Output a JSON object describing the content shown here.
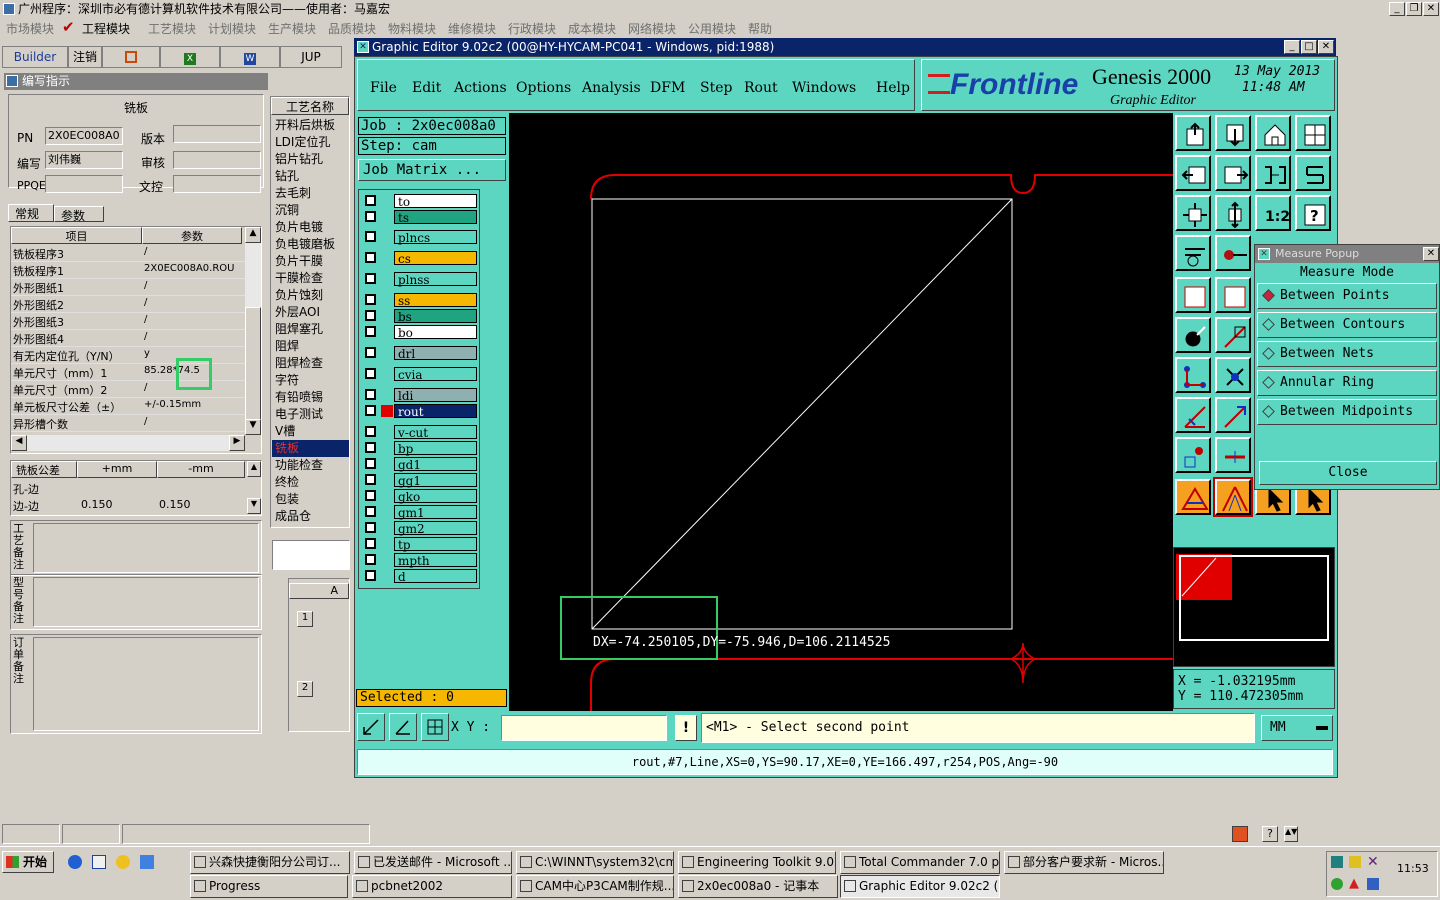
{
  "app": {
    "title": "广州程序：深圳市必有德计算机软件技术有限公司——使用者：马嘉宏",
    "menu": [
      "市场模块",
      "工程模块",
      "工艺模块",
      "计划模块",
      "生产模块",
      "品质模块",
      "物料模块",
      "维修模块",
      "行政模块",
      "成本模块",
      "网络模块",
      "公用模块",
      "帮助"
    ],
    "toolbar": [
      "Builder",
      "注销",
      "JUP"
    ]
  },
  "left": {
    "title": "编写指示",
    "board_type": "铣板",
    "fields": {
      "pn_label": "PN",
      "pn": "2X0EC008A0",
      "version_label": "版本",
      "version": "",
      "author_label": "编写",
      "author": "刘伟巍",
      "review_label": "审核",
      "review": "",
      "ppqe_label": "PPQE",
      "ppqe": "",
      "doc_control_label": "文控",
      "doc_control": ""
    },
    "tabs": [
      "常规",
      "参数"
    ],
    "grid_headers": [
      "项目",
      "参数"
    ],
    "grid_rows": [
      [
        "铣板程序3",
        "/"
      ],
      [
        "铣板程序1",
        "2X0EC008A0.ROU"
      ],
      [
        "外形图纸1",
        "/"
      ],
      [
        "外形图纸2",
        "/"
      ],
      [
        "外形图纸3",
        "/"
      ],
      [
        "外形图纸4",
        "/"
      ],
      [
        "有无内定位孔（Y/N）",
        "y"
      ],
      [
        "单元尺寸（mm）1",
        "85.28*74.5"
      ],
      [
        "单元尺寸（mm）2",
        "/"
      ],
      [
        "单元板尺寸公差（±）",
        "+/-0.15mm"
      ],
      [
        "异形槽个数",
        "/"
      ]
    ],
    "tol_headers": [
      "铣板公差",
      "+mm",
      "-mm"
    ],
    "tol_rows": [
      [
        "孔-边",
        "",
        ""
      ],
      [
        "边-边",
        "0.150",
        "0.150"
      ]
    ],
    "notes": [
      "工艺备注",
      "型号备注",
      "订单备注"
    ]
  },
  "process": {
    "header": "工艺名称",
    "items": [
      "开料后烘板",
      "LDI定位孔",
      "铝片钻孔",
      "钻孔",
      "去毛刺",
      "沉铜",
      "负片电镀",
      "负电镀磨板",
      "负片干膜",
      "干膜检查",
      "负片蚀刻",
      "外层AOI",
      "阻焊塞孔",
      "阻焊",
      "阻焊检查",
      "字符",
      "有铅喷锡",
      "电子测试",
      "V槽",
      "铣板",
      "功能检查",
      "终检",
      "包装",
      "成品仓"
    ],
    "selected": "铣板",
    "col_header": "A",
    "rows": [
      "1",
      "2"
    ]
  },
  "ge": {
    "title": "Graphic Editor 9.02c2 (00@HY-HYCAM-PC041 - Windows, pid:1988)",
    "menu": [
      "File",
      "Edit",
      "Actions",
      "Options",
      "Analysis",
      "DFM",
      "Step",
      "Rout",
      "Windows",
      "Help"
    ],
    "brand": "Frontline",
    "product": "Genesis 2000",
    "subtitle": "Graphic Editor",
    "date": "13 May 2013",
    "time": "11:48 AM",
    "job": "Job : 2x0ec008a0",
    "step": "Step: cam",
    "job_matrix": "Job Matrix ...",
    "layers": [
      {
        "name": "to",
        "color": "#ffffff"
      },
      {
        "name": "ts",
        "color": "#1fa380"
      },
      {
        "name": "plncs",
        "color": "#5cd6c1"
      },
      {
        "name": "cs",
        "color": "#f5b700"
      },
      {
        "name": "plnss",
        "color": "#5cd6c1"
      },
      {
        "name": "ss",
        "color": "#f5b700"
      },
      {
        "name": "bs",
        "color": "#1fa380"
      },
      {
        "name": "bo",
        "color": "#ffffff"
      },
      {
        "name": "drl",
        "color": "#8fb0b0"
      },
      {
        "name": "cvia",
        "color": "#5cd6c1"
      },
      {
        "name": "ldi",
        "color": "#8fb0b0"
      },
      {
        "name": "rout",
        "color": "#0a246a"
      },
      {
        "name": "v-cut",
        "color": "#5cd6c1"
      },
      {
        "name": "bp",
        "color": "#5cd6c1"
      },
      {
        "name": "gd1",
        "color": "#5cd6c1"
      },
      {
        "name": "gg1",
        "color": "#5cd6c1"
      },
      {
        "name": "gko",
        "color": "#5cd6c1"
      },
      {
        "name": "gm1",
        "color": "#5cd6c1"
      },
      {
        "name": "gm2",
        "color": "#5cd6c1"
      },
      {
        "name": "tp",
        "color": "#5cd6c1"
      },
      {
        "name": "mpth",
        "color": "#5cd6c1"
      },
      {
        "name": "d",
        "color": "#5cd6c1"
      }
    ],
    "selected": "Selected : 0",
    "measure": "DX=-74.250105,DY=-75.946,D=106.2114525",
    "xy_label": "X Y :",
    "xy_value": "",
    "prompt": "<M1> - Select second point",
    "units": "MM",
    "coord_x": "X = -1.032195mm",
    "coord_y": "Y = 110.472305mm",
    "status": "rout,#7,Line,XS=0,YS=90.17,XE=0,YE=166.497,r254,POS,Ang=-90"
  },
  "measure_popup": {
    "title": "Measure Popup",
    "mode": "Measure Mode",
    "options": [
      "Between Points",
      "Between Contours",
      "Between Nets",
      "Annular Ring",
      "Between Midpoints"
    ],
    "selected": "Between Points",
    "close": "Close"
  },
  "taskbar": {
    "start": "开始",
    "clock": "11:53",
    "tasks": [
      "兴森快捷衡阳分公司订...",
      "已发送邮件 - Microsoft ...",
      "C:\\WINNT\\system32\\cmd...",
      "Engineering Toolkit 9.02c...",
      "Total Commander 7.0 pub...",
      "部分客户要求新 - Micros...",
      "Progress",
      "pcbnet2002",
      "CAM中心P3CAM制作规...",
      "2x0ec008a0 - 记事本",
      "Graphic Editor 9.02c2 (00..."
    ]
  }
}
